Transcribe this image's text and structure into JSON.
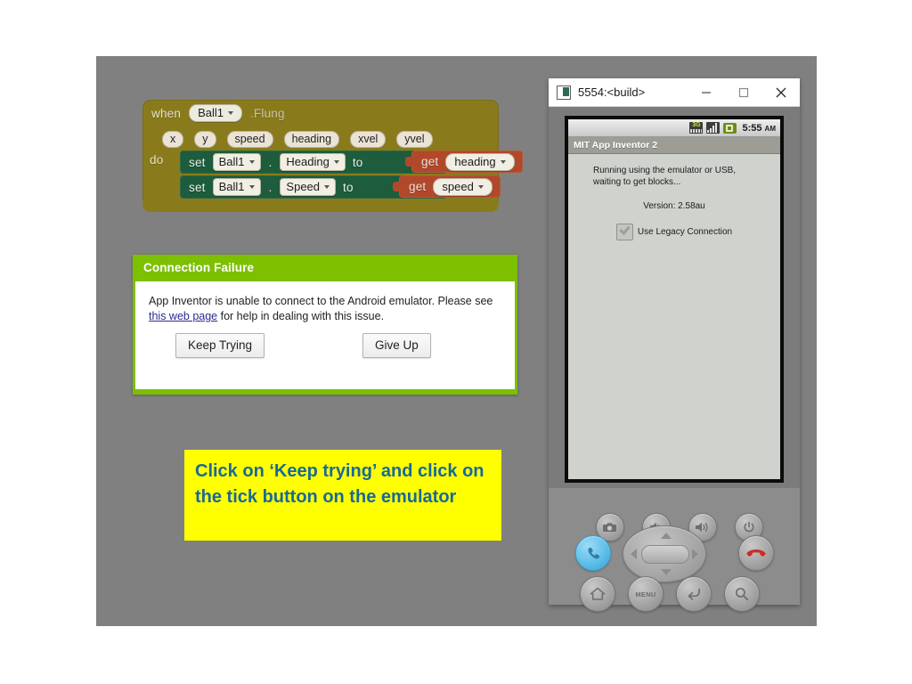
{
  "slide": {
    "background_color": "#808080"
  },
  "blocks": {
    "when_keyword": "when",
    "component": "Ball1",
    "event": ".Flung",
    "params": [
      "x",
      "y",
      "speed",
      "heading",
      "xvel",
      "yvel"
    ],
    "do_keyword": "do",
    "statements": [
      {
        "set_keyword": "set",
        "component": "Ball1",
        "separator": ".",
        "property": "Heading",
        "to_keyword": "to",
        "value_keyword": "get",
        "value": "heading"
      },
      {
        "set_keyword": "set",
        "component": "Ball1",
        "separator": ".",
        "property": "Speed",
        "to_keyword": "to",
        "value_keyword": "get",
        "value": "speed"
      }
    ],
    "colors": {
      "event_block": "#8a7b18",
      "set_block": "#1d5c3c",
      "get_block": "#b1482a"
    }
  },
  "dialog": {
    "title": "Connection Failure",
    "message_before_link": "App Inventor is unable to connect to the Android emulator. Please see ",
    "link_text": "this web page",
    "message_after_link": " for help in dealing with this issue.",
    "keep_trying_label": "Keep Trying",
    "give_up_label": "Give Up",
    "header_color": "#7cc000"
  },
  "callout": {
    "text": "Click on ‘Keep trying’ and click on the tick button on the emulator",
    "background_color": "#ffff00",
    "text_color": "#17699b"
  },
  "emulator": {
    "window_title": "5554:<build>",
    "window_controls": {
      "minimize": "minimize-icon",
      "maximize": "maximize-icon",
      "close": "close-icon"
    },
    "status_bar": {
      "network_label": "3G",
      "time": "5:55",
      "ampm": "AM",
      "icons": [
        "network-3g-icon",
        "signal-bars-icon",
        "battery-icon"
      ]
    },
    "app_bar_title": "MIT App Inventor 2",
    "content": {
      "line1": "Running using the emulator or USB,",
      "line2": "waiting to get blocks...",
      "version": "Version: 2.58au",
      "checkbox_label": "Use Legacy Connection",
      "checkbox_checked": true
    },
    "keypad": {
      "camera": "camera-button",
      "volume_down": "volume-down-button",
      "volume_up": "volume-up-button",
      "power": "power-button",
      "call": "call-button",
      "end_call": "end-call-button",
      "home": "home-button",
      "menu_label": "MENU",
      "back": "back-button",
      "search": "search-button"
    }
  }
}
